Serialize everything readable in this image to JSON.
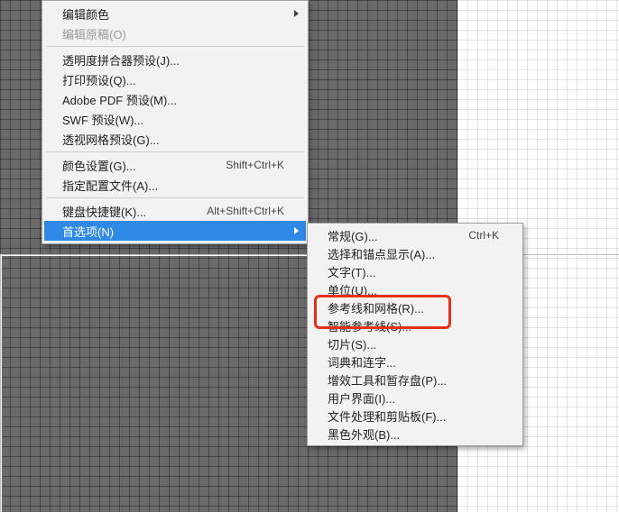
{
  "primary_menu": {
    "items": [
      {
        "label": "编辑颜色",
        "submenu": true
      },
      {
        "label": "编辑原稿(O)",
        "disabled": true
      },
      {
        "sep": true
      },
      {
        "label": "透明度拼合器预设(J)..."
      },
      {
        "label": "打印预设(Q)..."
      },
      {
        "label": "Adobe PDF 预设(M)..."
      },
      {
        "label": "SWF 预设(W)..."
      },
      {
        "label": "透视网格预设(G)..."
      },
      {
        "sep": true
      },
      {
        "label": "颜色设置(G)...",
        "accel": "Shift+Ctrl+K"
      },
      {
        "label": "指定配置文件(A)..."
      },
      {
        "sep": true
      },
      {
        "label": "键盘快捷键(K)...",
        "accel": "Alt+Shift+Ctrl+K"
      },
      {
        "label": "首选项(N)",
        "submenu": true,
        "highlight": true
      }
    ]
  },
  "secondary_menu": {
    "items": [
      {
        "label": "常规(G)...",
        "accel": "Ctrl+K"
      },
      {
        "label": "选择和锚点显示(A)..."
      },
      {
        "label": "文字(T)..."
      },
      {
        "label": "单位(U)..."
      },
      {
        "label": "参考线和网格(R)...",
        "emph": true
      },
      {
        "label": "智能参考线(S)..."
      },
      {
        "label": "切片(S)..."
      },
      {
        "label": "词典和连字..."
      },
      {
        "label": "增效工具和暂存盘(P)..."
      },
      {
        "label": "用户界面(I)..."
      },
      {
        "label": "文件处理和剪贴板(F)..."
      },
      {
        "label": "黑色外观(B)..."
      }
    ]
  }
}
